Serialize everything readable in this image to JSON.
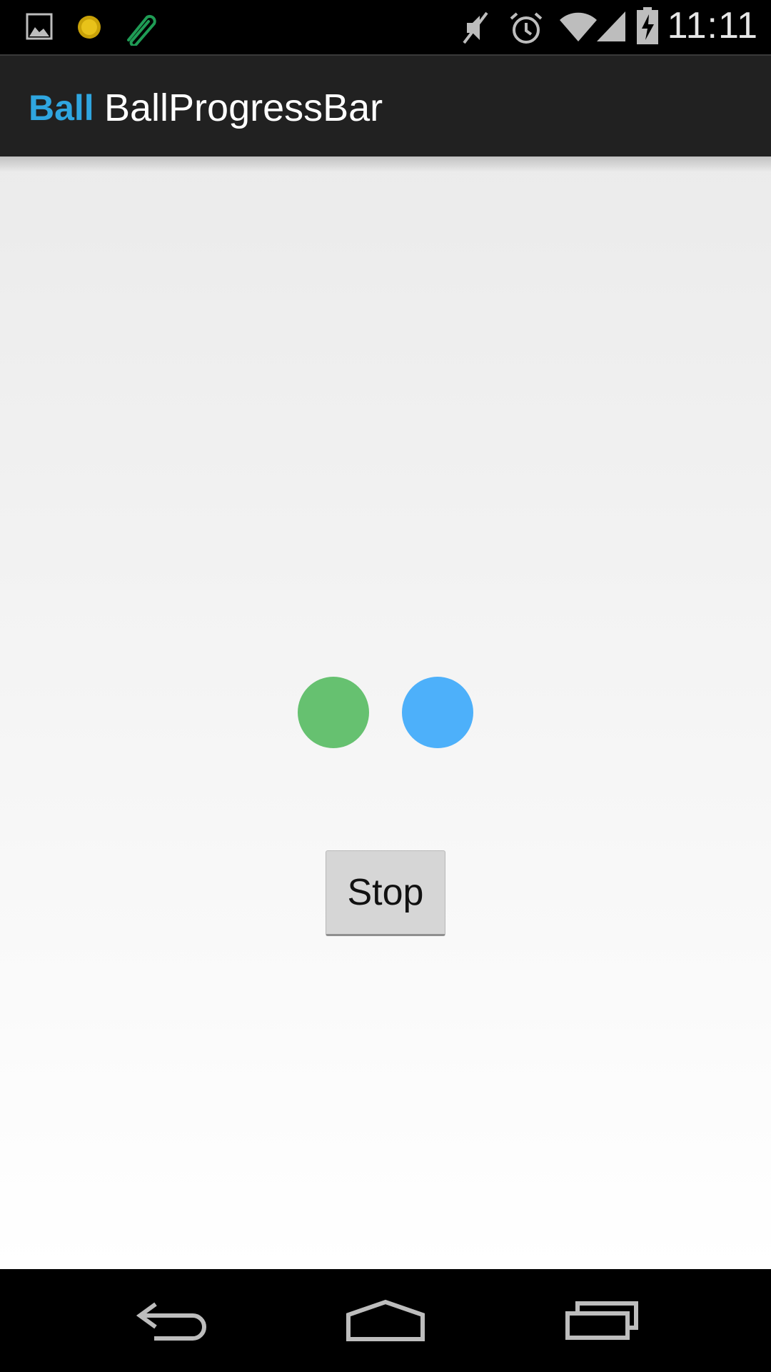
{
  "status_bar": {
    "time": "11:11",
    "left_icons": [
      "image-notification-icon",
      "coin-notification-icon",
      "paperclip-notification-icon"
    ],
    "right_icons": [
      "mute-icon",
      "alarm-icon",
      "wifi-icon",
      "signal-icon",
      "battery-charging-icon"
    ]
  },
  "action_bar": {
    "logo_text": "Ball",
    "title": "BallProgressBar"
  },
  "progress": {
    "balls": [
      {
        "color": "#66c170"
      },
      {
        "color": "#4db0fa"
      }
    ]
  },
  "stop_button": {
    "label": "Stop"
  },
  "nav_bar": {
    "buttons": [
      "back",
      "home",
      "recents"
    ]
  }
}
